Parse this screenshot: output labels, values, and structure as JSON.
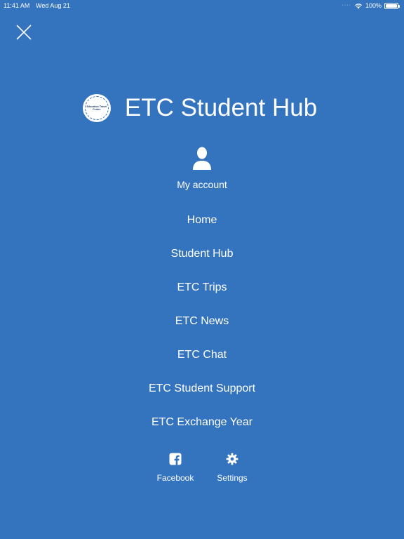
{
  "status_bar": {
    "time": "11:41 AM",
    "date": "Wed Aug 21",
    "battery": "100%",
    "battery_level": 1.0
  },
  "header": {
    "logo_text": "Education Travel Centre",
    "title": "ETC Student Hub"
  },
  "account": {
    "icon": "user-icon",
    "label": "My account"
  },
  "menu": {
    "items": [
      {
        "label": "Home"
      },
      {
        "label": "Student Hub"
      },
      {
        "label": "ETC Trips"
      },
      {
        "label": "ETC News"
      },
      {
        "label": "ETC Chat"
      },
      {
        "label": "ETC Student Support"
      },
      {
        "label": "ETC Exchange Year"
      }
    ]
  },
  "footer": {
    "facebook": {
      "icon": "facebook-icon",
      "label": "Facebook"
    },
    "settings": {
      "icon": "gear-icon",
      "label": "Settings"
    }
  },
  "colors": {
    "background": "#3473bd",
    "text": "#ffffff"
  }
}
